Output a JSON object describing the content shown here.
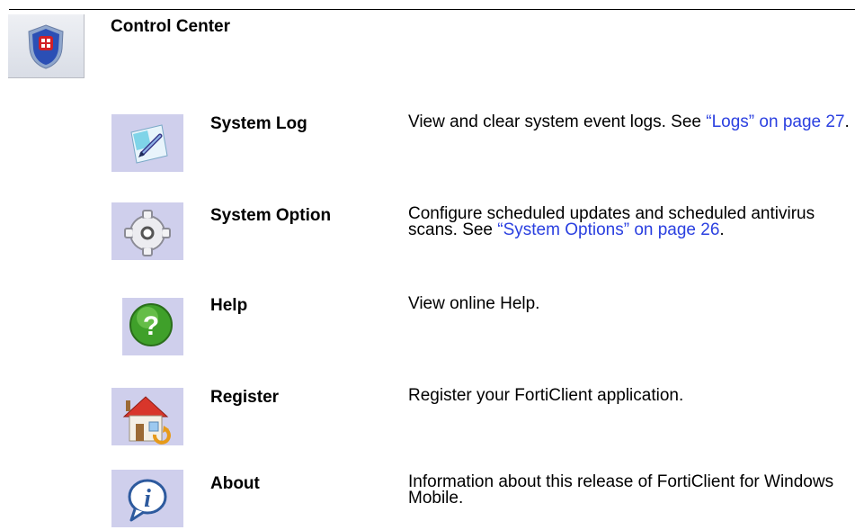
{
  "section": {
    "title": "Control Center"
  },
  "items": [
    {
      "name": "System Log",
      "icon": "notepad-pencil-icon",
      "desc_before": "View and clear system event logs. See ",
      "desc_link": "“Logs” on page 27",
      "desc_after": "."
    },
    {
      "name": "System Option",
      "icon": "gear-icon",
      "desc_before": "Configure scheduled updates and scheduled antivirus scans. See ",
      "desc_link": "“System Options” on page 26",
      "desc_after": "."
    },
    {
      "name": "Help",
      "icon": "help-question-icon",
      "desc_before": "View online Help.",
      "desc_link": "",
      "desc_after": ""
    },
    {
      "name": "Register",
      "icon": "house-register-icon",
      "desc_before": "Register your FortiClient application.",
      "desc_link": "",
      "desc_after": ""
    },
    {
      "name": "About",
      "icon": "info-icon",
      "desc_before": "Information about this release of FortiClient for Windows Mobile.",
      "desc_link": "",
      "desc_after": ""
    }
  ],
  "colors": {
    "link": "#2b40e0",
    "icon_bg": "#cfcfec"
  }
}
